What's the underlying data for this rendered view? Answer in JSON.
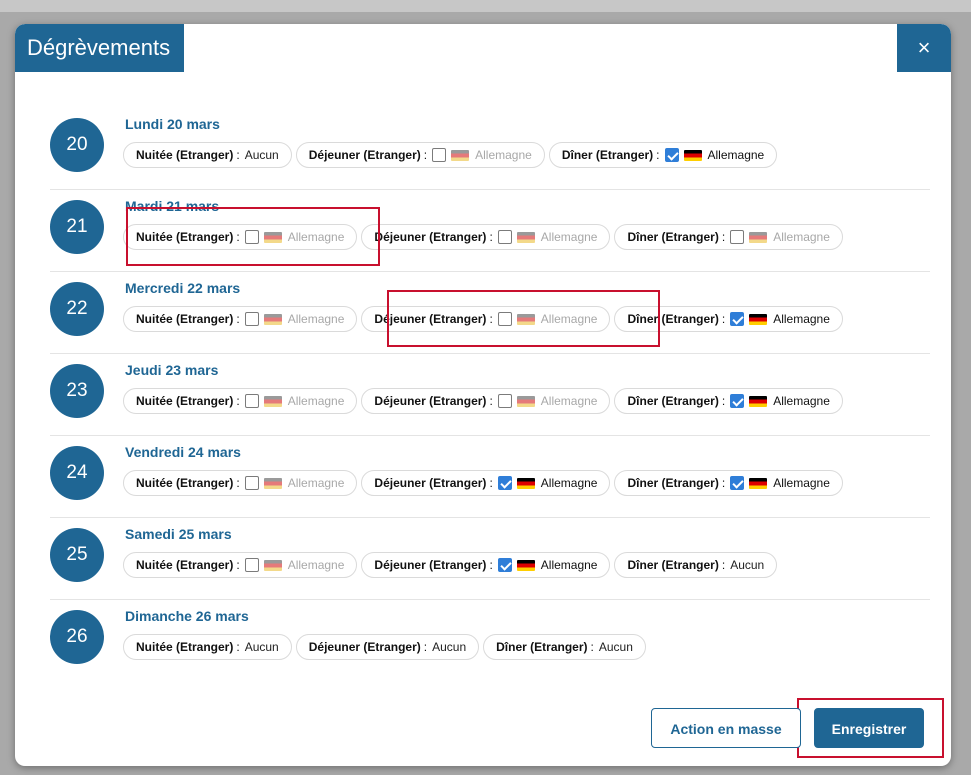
{
  "modal": {
    "title": "Dégrèvements",
    "close_glyph": "×",
    "days": [
      {
        "number": "20",
        "title": "Lundi 20 mars",
        "chips": [
          {
            "label": "Nuitée (Etranger)",
            "kind": "text",
            "value": "Aucun"
          },
          {
            "label": "Déjeuner (Etranger)",
            "kind": "check",
            "checked": false,
            "country": "Allemagne"
          },
          {
            "label": "Dîner (Etranger)",
            "kind": "check",
            "checked": true,
            "country": "Allemagne"
          }
        ]
      },
      {
        "number": "21",
        "title": "Mardi 21 mars",
        "chips": [
          {
            "label": "Nuitée (Etranger)",
            "kind": "check",
            "checked": false,
            "country": "Allemagne"
          },
          {
            "label": "Déjeuner (Etranger)",
            "kind": "check",
            "checked": false,
            "country": "Allemagne"
          },
          {
            "label": "Dîner (Etranger)",
            "kind": "check",
            "checked": false,
            "country": "Allemagne"
          }
        ]
      },
      {
        "number": "22",
        "title": "Mercredi 22 mars",
        "chips": [
          {
            "label": "Nuitée (Etranger)",
            "kind": "check",
            "checked": false,
            "country": "Allemagne"
          },
          {
            "label": "Déjeuner (Etranger)",
            "kind": "check",
            "checked": false,
            "country": "Allemagne"
          },
          {
            "label": "Dîner (Etranger)",
            "kind": "check",
            "checked": true,
            "country": "Allemagne"
          }
        ]
      },
      {
        "number": "23",
        "title": "Jeudi 23 mars",
        "chips": [
          {
            "label": "Nuitée (Etranger)",
            "kind": "check",
            "checked": false,
            "country": "Allemagne"
          },
          {
            "label": "Déjeuner (Etranger)",
            "kind": "check",
            "checked": false,
            "country": "Allemagne"
          },
          {
            "label": "Dîner (Etranger)",
            "kind": "check",
            "checked": true,
            "country": "Allemagne"
          }
        ]
      },
      {
        "number": "24",
        "title": "Vendredi 24 mars",
        "chips": [
          {
            "label": "Nuitée (Etranger)",
            "kind": "check",
            "checked": false,
            "country": "Allemagne"
          },
          {
            "label": "Déjeuner (Etranger)",
            "kind": "check",
            "checked": true,
            "country": "Allemagne"
          },
          {
            "label": "Dîner (Etranger)",
            "kind": "check",
            "checked": true,
            "country": "Allemagne"
          }
        ]
      },
      {
        "number": "25",
        "title": "Samedi 25 mars",
        "chips": [
          {
            "label": "Nuitée (Etranger)",
            "kind": "check",
            "checked": false,
            "country": "Allemagne"
          },
          {
            "label": "Déjeuner (Etranger)",
            "kind": "check",
            "checked": true,
            "country": "Allemagne"
          },
          {
            "label": "Dîner (Etranger)",
            "kind": "text",
            "value": "Aucun"
          }
        ]
      },
      {
        "number": "26",
        "title": "Dimanche 26 mars",
        "chips": [
          {
            "label": "Nuitée (Etranger)",
            "kind": "text",
            "value": "Aucun"
          },
          {
            "label": "Déjeuner (Etranger)",
            "kind": "text",
            "value": "Aucun"
          },
          {
            "label": "Dîner (Etranger)",
            "kind": "text",
            "value": "Aucun"
          }
        ]
      }
    ],
    "footer": {
      "secondary_label": "Action en masse",
      "primary_label": "Enregistrer"
    }
  },
  "colors": {
    "primary": "#1f6694",
    "checkbox_checked": "#2f7ed8",
    "highlight": "#c8102e"
  },
  "icons": {
    "flag": "germany-flag-icon",
    "close": "close-icon",
    "checkbox": "checkbox-icon"
  }
}
